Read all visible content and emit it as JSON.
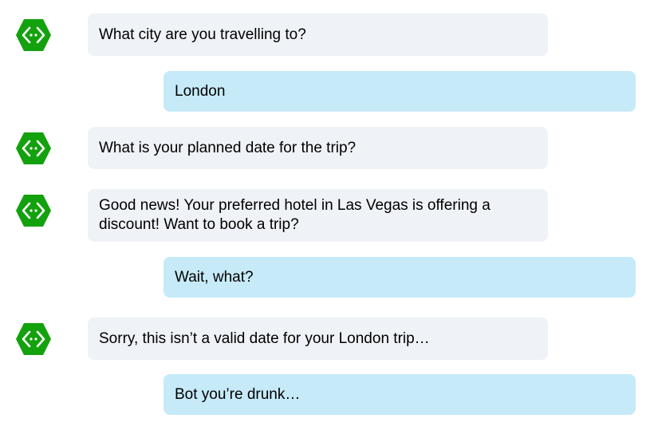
{
  "conversation": {
    "messages": [
      {
        "sender": "bot",
        "text": "What city are you travelling to?",
        "avatar_icon": "bot-hexagon-icon"
      },
      {
        "sender": "user",
        "text": "London"
      },
      {
        "sender": "bot",
        "text": "What is your planned date for the trip?",
        "avatar_icon": "bot-hexagon-icon"
      },
      {
        "sender": "bot",
        "text": "Good news! Your preferred hotel in Las Vegas is offering a discount! Want to book a trip?",
        "avatar_icon": "bot-hexagon-icon"
      },
      {
        "sender": "user",
        "text": "Wait, what?"
      },
      {
        "sender": "bot",
        "text": "Sorry, this isn’t a valid date for your London trip…",
        "avatar_icon": "bot-hexagon-icon"
      },
      {
        "sender": "user",
        "text": "Bot you’re drunk…"
      }
    ]
  },
  "colors": {
    "bot_bubble": "#eff2f6",
    "user_bubble": "#c6eaf8",
    "avatar_green": "#13a10e"
  }
}
